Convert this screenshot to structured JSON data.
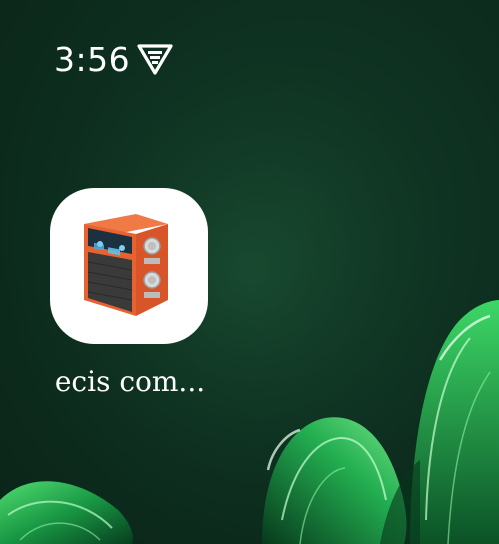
{
  "status_bar": {
    "time": "3:56",
    "vpn_icon": "shield-vpn-icon"
  },
  "home_screen": {
    "apps": [
      {
        "label": "ecis com...",
        "icon": "device-machine-icon"
      }
    ]
  },
  "colors": {
    "wallpaper": "#0d2e1f",
    "accent_green": "#2fd160",
    "device_orange": "#e8622f"
  }
}
